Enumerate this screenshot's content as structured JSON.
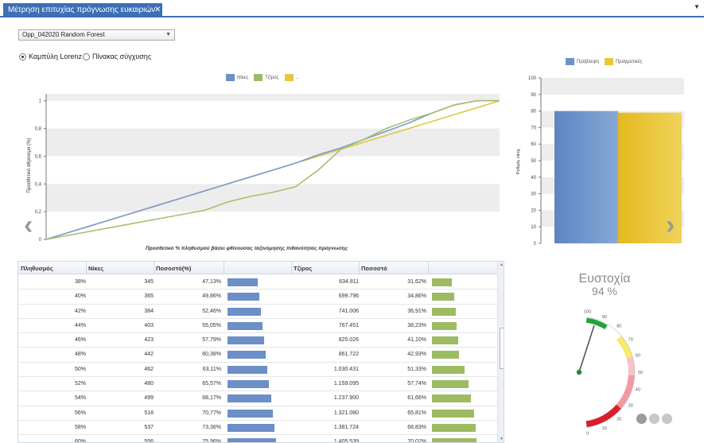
{
  "tab": {
    "title": "Μέτρηση επιτυχίας πρόγνωσης ευκαιριών",
    "pin_icon": "pin-icon",
    "close_icon": "close-icon"
  },
  "window_menu_icon": "chevron-down-icon",
  "model_select": {
    "value": "Opp_042020  Random Forest"
  },
  "view_options": [
    {
      "label": "Καμπύλη Lorenz",
      "selected": true
    },
    {
      "label": "Πίνακας σύγχυσης",
      "selected": false
    }
  ],
  "lorenz": {
    "legend": [
      {
        "label": "Νίκες",
        "color": "#6d8fc7"
      },
      {
        "label": "Τζίρος",
        "color": "#9dbb61"
      },
      {
        "label": "..",
        "color": "#e0c844"
      }
    ],
    "ylabel": "Προσθετικό αθροισμα (%)",
    "xlabel": "Προσθετικό % πληθυσμού βάσει φθίνουσας ταξινόμησης πιθανότητας πρόγνωσης",
    "y_ticks": [
      "0",
      "0,2",
      "0,4",
      "0,6",
      "0,8",
      "1"
    ]
  },
  "chart_data": [
    {
      "type": "line",
      "title": "",
      "xlabel": "Προσθετικό % πληθυσμού βάσει φθίνουσας ταξινόμησης πιθανότητας πρόγνωσης",
      "ylabel": "Προσθετικό αθροισμα (%)",
      "ylim": [
        0,
        1.05
      ],
      "xlim": [
        0,
        1
      ],
      "x": [
        0,
        0.05,
        0.1,
        0.15,
        0.2,
        0.25,
        0.3,
        0.35,
        0.4,
        0.45,
        0.5,
        0.55,
        0.6,
        0.65,
        0.7,
        0.75,
        0.8,
        0.85,
        0.9,
        0.95,
        1
      ],
      "series": [
        {
          "name": "Νίκες",
          "values": [
            0,
            0.05,
            0.1,
            0.15,
            0.2,
            0.25,
            0.3,
            0.35,
            0.4,
            0.45,
            0.5,
            0.55,
            0.61,
            0.66,
            0.72,
            0.78,
            0.84,
            0.91,
            0.97,
            1.0,
            1.0
          ]
        },
        {
          "name": "Τζίρος",
          "values": [
            0,
            0.03,
            0.06,
            0.09,
            0.12,
            0.15,
            0.18,
            0.21,
            0.27,
            0.31,
            0.34,
            0.38,
            0.5,
            0.65,
            0.72,
            0.8,
            0.86,
            0.91,
            0.97,
            1.0,
            1.0
          ]
        },
        {
          "name": "..",
          "values": [
            0,
            0.05,
            0.1,
            0.15,
            0.2,
            0.25,
            0.3,
            0.35,
            0.4,
            0.45,
            0.5,
            0.55,
            0.6,
            0.65,
            0.7,
            0.75,
            0.8,
            0.85,
            0.9,
            0.95,
            1.0
          ]
        }
      ]
    },
    {
      "type": "bar",
      "categories": [
        "Πρόβλεψη",
        "Πραγματικές"
      ],
      "values": [
        80,
        79
      ],
      "ylabel": "Ρυθμός νίκης",
      "ylim": [
        0,
        100
      ],
      "y_ticks": [
        0,
        10,
        20,
        30,
        40,
        50,
        60,
        70,
        80,
        90,
        100
      ],
      "colors": [
        "#6a93c9",
        "#eac534"
      ]
    }
  ],
  "table": {
    "columns": [
      "Πληθυσμός",
      "Νίκες",
      "Ποσοστό(%)",
      "",
      "Τζίρος",
      "Ποσοστό",
      ""
    ],
    "bar_colors": {
      "wins": "#6d8fc7",
      "revenue": "#9dbb61"
    },
    "rows": [
      {
        "population": "38%",
        "wins": "345",
        "pct": "47,13%",
        "wins_share": 0.4713,
        "revenue": "634.811",
        "rev_pct": "31,62%",
        "rev_share": 0.3162
      },
      {
        "population": "40%",
        "wins": "365",
        "pct": "49,86%",
        "wins_share": 0.4986,
        "revenue": "699.796",
        "rev_pct": "34,86%",
        "rev_share": 0.3486
      },
      {
        "population": "42%",
        "wins": "384",
        "pct": "52,46%",
        "wins_share": 0.5246,
        "revenue": "741.006",
        "rev_pct": "36,91%",
        "rev_share": 0.3691
      },
      {
        "population": "44%",
        "wins": "403",
        "pct": "55,05%",
        "wins_share": 0.5505,
        "revenue": "767.451",
        "rev_pct": "38,23%",
        "rev_share": 0.3823
      },
      {
        "population": "46%",
        "wins": "423",
        "pct": "57,79%",
        "wins_share": 0.5779,
        "revenue": "825.026",
        "rev_pct": "41,10%",
        "rev_share": 0.411
      },
      {
        "population": "48%",
        "wins": "442",
        "pct": "60,38%",
        "wins_share": 0.6038,
        "revenue": "861.722",
        "rev_pct": "42,93%",
        "rev_share": 0.4293
      },
      {
        "population": "50%",
        "wins": "462",
        "pct": "63,11%",
        "wins_share": 0.6311,
        "revenue": "1.030.431",
        "rev_pct": "51,33%",
        "rev_share": 0.5133
      },
      {
        "population": "52%",
        "wins": "480",
        "pct": "65,57%",
        "wins_share": 0.6557,
        "revenue": "1.159.095",
        "rev_pct": "57,74%",
        "rev_share": 0.5774
      },
      {
        "population": "54%",
        "wins": "499",
        "pct": "68,17%",
        "wins_share": 0.6817,
        "revenue": "1.237.900",
        "rev_pct": "61,66%",
        "rev_share": 0.6166
      },
      {
        "population": "56%",
        "wins": "518",
        "pct": "70,77%",
        "wins_share": 0.7077,
        "revenue": "1.321.080",
        "rev_pct": "65,81%",
        "rev_share": 0.6581
      },
      {
        "population": "58%",
        "wins": "537",
        "pct": "73,36%",
        "wins_share": 0.7336,
        "revenue": "1.381.724",
        "rev_pct": "68,83%",
        "rev_share": 0.6883
      },
      {
        "population": "60%",
        "wins": "556",
        "pct": "75,96%",
        "wins_share": 0.7596,
        "revenue": "1.405.539",
        "rev_pct": "70,02%",
        "rev_share": 0.7002
      }
    ]
  },
  "accuracy": {
    "title": "Ευστοχία",
    "value_text": "94 %",
    "value": 94,
    "scale_labels": [
      "100",
      "90",
      "80",
      "70",
      "60",
      "50",
      "40",
      "30",
      "20",
      "10",
      "0"
    ]
  },
  "carousel": {
    "page_count": 3,
    "active_index": 0
  },
  "nav": {
    "prev_icon": "chevron-left-icon",
    "next_icon": "chevron-right-icon"
  }
}
